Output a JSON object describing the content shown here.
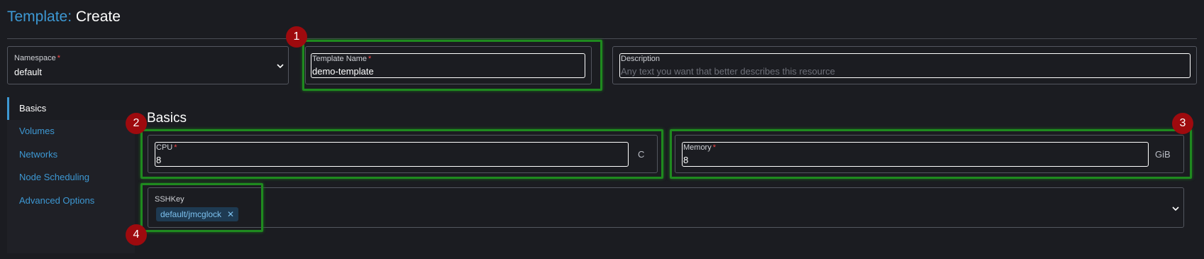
{
  "header": {
    "title_prefix": "Template:",
    "title_action": "Create"
  },
  "form": {
    "namespace": {
      "label": "Namespace",
      "required_mark": "*",
      "value": "default"
    },
    "template_name": {
      "label": "Template Name",
      "required_mark": "*",
      "value": "demo-template"
    },
    "description": {
      "label": "Description",
      "placeholder": "Any text you want that better describes this resource"
    }
  },
  "sidebar": {
    "items": [
      {
        "label": "Basics",
        "active": true
      },
      {
        "label": "Volumes"
      },
      {
        "label": "Networks"
      },
      {
        "label": "Node Scheduling"
      },
      {
        "label": "Advanced Options"
      }
    ]
  },
  "basics": {
    "heading": "Basics",
    "cpu": {
      "label": "CPU",
      "required_mark": "*",
      "value": "8",
      "unit": "C"
    },
    "memory": {
      "label": "Memory",
      "required_mark": "*",
      "value": "8",
      "unit": "GiB"
    },
    "sshkey": {
      "label": "SSHKey",
      "chips": [
        "default/jmcglock"
      ]
    }
  },
  "annotations": {
    "badges": [
      "1",
      "2",
      "3",
      "4"
    ],
    "highlight_color": "#1f8a1f",
    "badge_color": "#9e0a0e"
  },
  "colors": {
    "accent": "#3d98d3",
    "required": "#f64747",
    "background": "#1b1c21"
  }
}
